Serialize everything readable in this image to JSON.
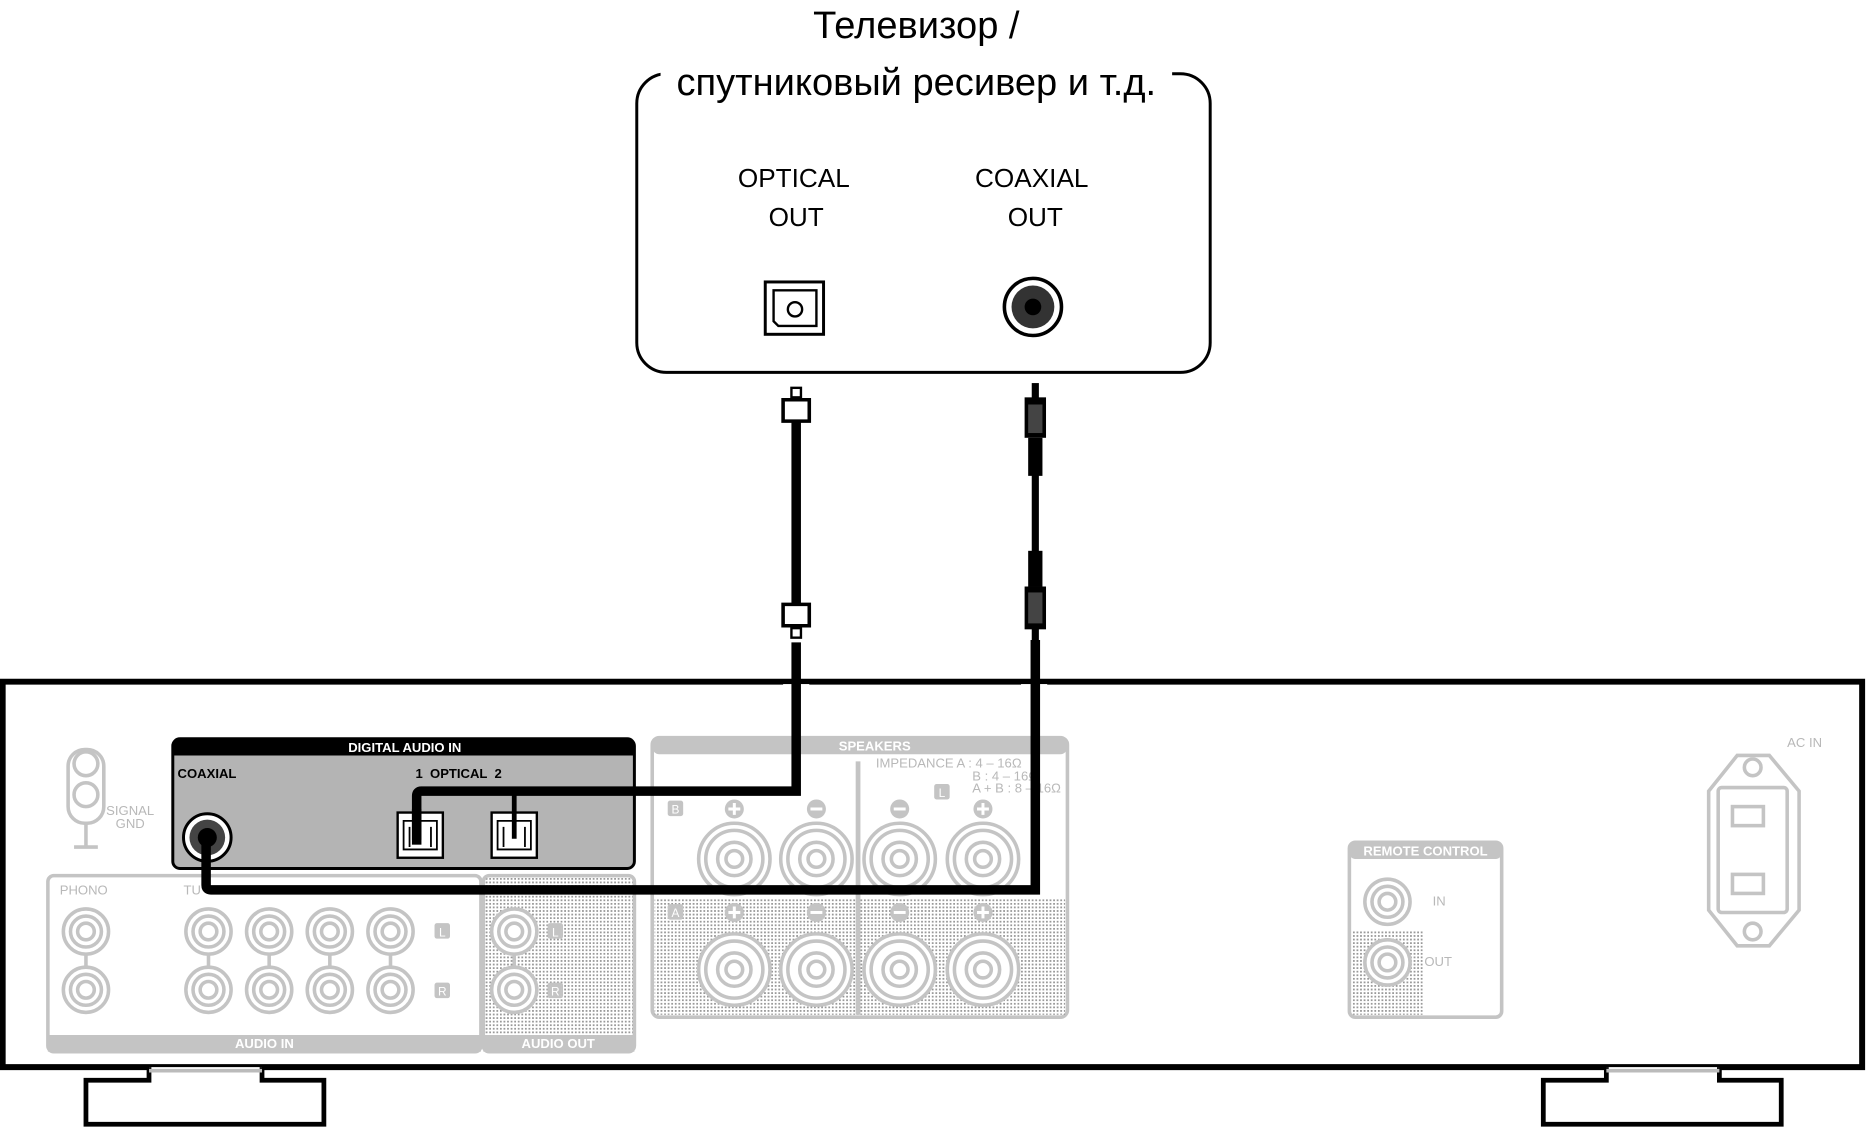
{
  "source_device": {
    "title_line1": "Телевизор /",
    "title_line2": "спутниковый ресивер и т.д.",
    "optical_label_1": "OPTICAL",
    "optical_label_2": "OUT",
    "coaxial_label_1": "COAXIAL",
    "coaxial_label_2": "OUT"
  },
  "amplifier": {
    "digital_audio_in": "DIGITAL AUDIO IN",
    "coaxial": "COAXIAL",
    "optical": "1  OPTICAL  2",
    "signal_gnd_1": "SIGNAL",
    "signal_gnd_2": "GND",
    "phono": "PHONO",
    "tuner": "TU",
    "audio_in": "AUDIO IN",
    "audio_out": "AUDIO OUT",
    "speakers": "SPEAKERS",
    "impedance_1": "IMPEDANCE  A     :  4 – 16Ω",
    "impedance_2": "B     :  4 – 16Ω",
    "impedance_3": "A + B :  8 – 16Ω",
    "spk_b": "B",
    "spk_a": "A",
    "left": "L",
    "right": "R",
    "remote_control": "REMOTE CONTROL",
    "remote_in": "IN",
    "remote_out": "OUT",
    "ac_in": "AC IN"
  }
}
